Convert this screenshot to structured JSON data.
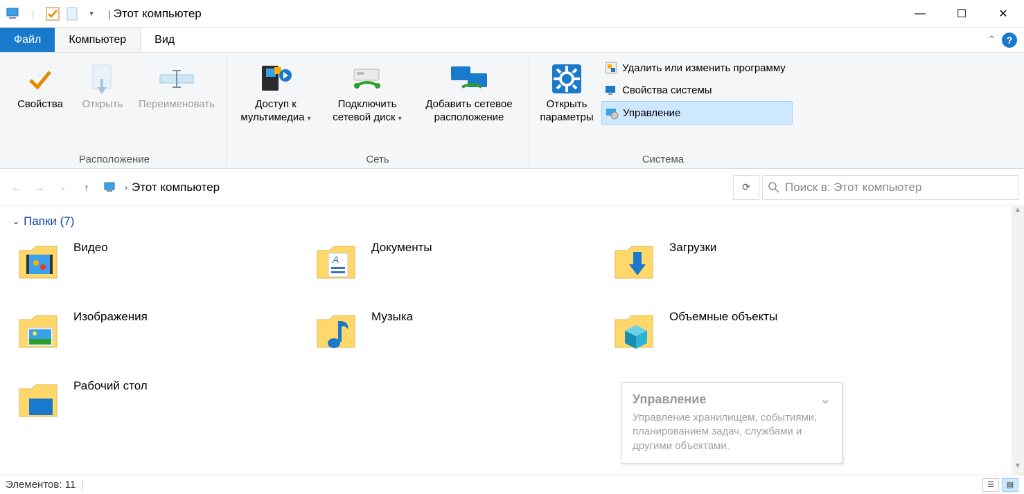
{
  "title": "Этот компьютер",
  "qat_dropdown_caret": "▾",
  "window_controls": {
    "minimize": "—",
    "maximize": "☐",
    "close": "✕"
  },
  "tabs": {
    "file": "Файл",
    "computer": "Компьютер",
    "view": "Вид"
  },
  "collapse_caret": "⌃",
  "help_glyph": "?",
  "ribbon": {
    "group_location": {
      "title": "Расположение",
      "properties": "Свойства",
      "open": "Открыть",
      "rename": "Переименовать"
    },
    "group_network": {
      "title": "Сеть",
      "media_access": "Доступ к мультимедиа",
      "map_drive": "Подключить сетевой диск",
      "add_location": "Добавить сетевое расположение"
    },
    "group_system": {
      "title": "Система",
      "open_settings": "Открыть параметры",
      "uninstall_program": "Удалить или изменить программу",
      "system_props": "Свойства системы",
      "manage": "Управление"
    }
  },
  "addr": {
    "breadcrumb_root": "Этот компьютер",
    "crumb_sep": "›",
    "refresh_glyph": "⟳",
    "search_placeholder": "Поиск в: Этот компьютер"
  },
  "section": {
    "folders_label": "Папки",
    "folders_count": "(7)"
  },
  "folders": {
    "video": "Видео",
    "documents": "Документы",
    "downloads": "Загрузки",
    "pictures": "Изображения",
    "music": "Музыка",
    "objects3d": "Объемные объекты",
    "desktop": "Рабочий стол"
  },
  "tooltip": {
    "title": "Управление",
    "chev": "⌄",
    "body": "Управление хранилищем, событиями, планированием задач, службами и другими объектами."
  },
  "status": {
    "items_label": "Элементов:",
    "items_count": "11"
  }
}
